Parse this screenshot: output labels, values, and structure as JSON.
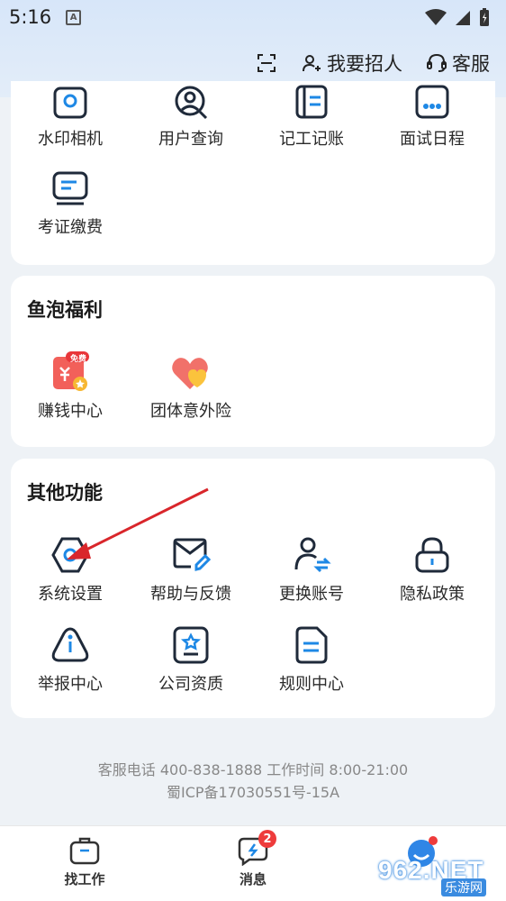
{
  "status": {
    "time": "5:16",
    "app_badge": "A"
  },
  "header": {
    "scan_label": "",
    "recruit_label": "我要招人",
    "service_label": "客服"
  },
  "tools": {
    "items": [
      {
        "label": "水印相机",
        "icon": "camera-icon"
      },
      {
        "label": "用户查询",
        "icon": "user-search-icon"
      },
      {
        "label": "记工记账",
        "icon": "ledger-icon"
      },
      {
        "label": "面试日程",
        "icon": "calendar-icon"
      },
      {
        "label": "考证缴费",
        "icon": "certificate-icon"
      }
    ]
  },
  "benefits": {
    "title": "鱼泡福利",
    "items": [
      {
        "label": "赚钱中心",
        "icon": "money-center-icon",
        "tag": "免费"
      },
      {
        "label": "团体意外险",
        "icon": "insurance-heart-icon"
      }
    ]
  },
  "other": {
    "title": "其他功能",
    "items": [
      {
        "label": "系统设置",
        "icon": "settings-icon"
      },
      {
        "label": "帮助与反馈",
        "icon": "mail-feedback-icon"
      },
      {
        "label": "更换账号",
        "icon": "switch-account-icon"
      },
      {
        "label": "隐私政策",
        "icon": "lock-icon"
      },
      {
        "label": "举报中心",
        "icon": "report-icon"
      },
      {
        "label": "公司资质",
        "icon": "qualification-icon"
      },
      {
        "label": "规则中心",
        "icon": "rules-icon"
      }
    ]
  },
  "footer": {
    "contact": "客服电话 400-838-1888 工作时间 8:00-21:00",
    "icp": "蜀ICP备17030551号-15A"
  },
  "tabbar": {
    "tabs": [
      {
        "label": "找工作",
        "icon": "briefcase-icon"
      },
      {
        "label": "消息",
        "icon": "message-icon",
        "badge": "2"
      },
      {
        "label": "",
        "icon": "profile-icon"
      }
    ]
  },
  "watermark": {
    "text": "962.NET",
    "sub": "乐游网"
  },
  "colors": {
    "accent": "#1e88e5",
    "icon_stroke": "#1f2a3a",
    "badge": "#ee3b3b",
    "arrow": "#d9262b"
  }
}
